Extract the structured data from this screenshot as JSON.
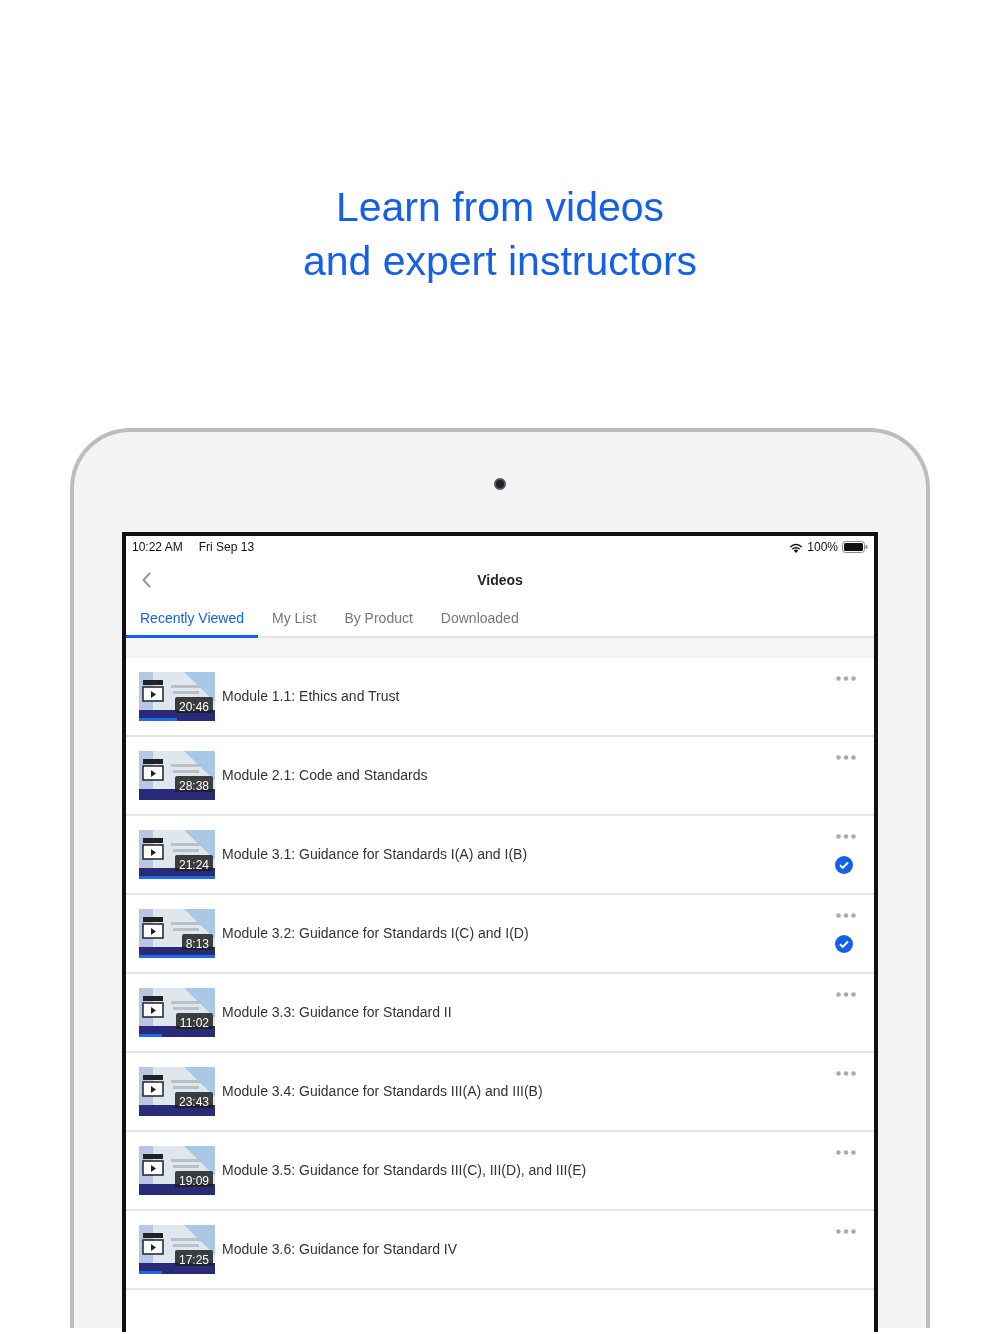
{
  "headline": {
    "lines": [
      "Learn from videos",
      "and expert instructors"
    ]
  },
  "status_bar": {
    "time": "10:22 AM",
    "date": "Fri Sep 13",
    "battery": "100%"
  },
  "nav": {
    "title": "Videos"
  },
  "tabs": [
    {
      "label": "Recently Viewed",
      "selected": true
    },
    {
      "label": "My List",
      "selected": false
    },
    {
      "label": "By Product",
      "selected": false
    },
    {
      "label": "Downloaded",
      "selected": false
    }
  ],
  "videos": [
    {
      "title": "Module 1.1: Ethics and Trust",
      "duration": "20:46",
      "level": 0.5,
      "completed": false
    },
    {
      "title": "Module 2.1: Code and Standards",
      "duration": "28:38",
      "level": 0,
      "completed": false
    },
    {
      "title": "Module 3.1: Guidance for Standards I(A) and I(B)",
      "duration": "21:24",
      "level": 1,
      "completed": true
    },
    {
      "title": "Module 3.2: Guidance for Standards I(C) and I(D)",
      "duration": "8:13",
      "level": 1,
      "completed": true
    },
    {
      "title": "Module 3.3: Guidance for Standard II",
      "duration": "11:02",
      "level": 0.3,
      "completed": false
    },
    {
      "title": "Module 3.4: Guidance for Standards III(A) and III(B)",
      "duration": "23:43",
      "level": 0,
      "completed": false
    },
    {
      "title": "Module 3.5: Guidance for Standards III(C), III(D), and III(E)",
      "duration": "19:09",
      "level": 0,
      "completed": false
    },
    {
      "title": "Module 3.6: Guidance for Standard IV",
      "duration": "17:25",
      "level": 0.3,
      "completed": false
    }
  ]
}
